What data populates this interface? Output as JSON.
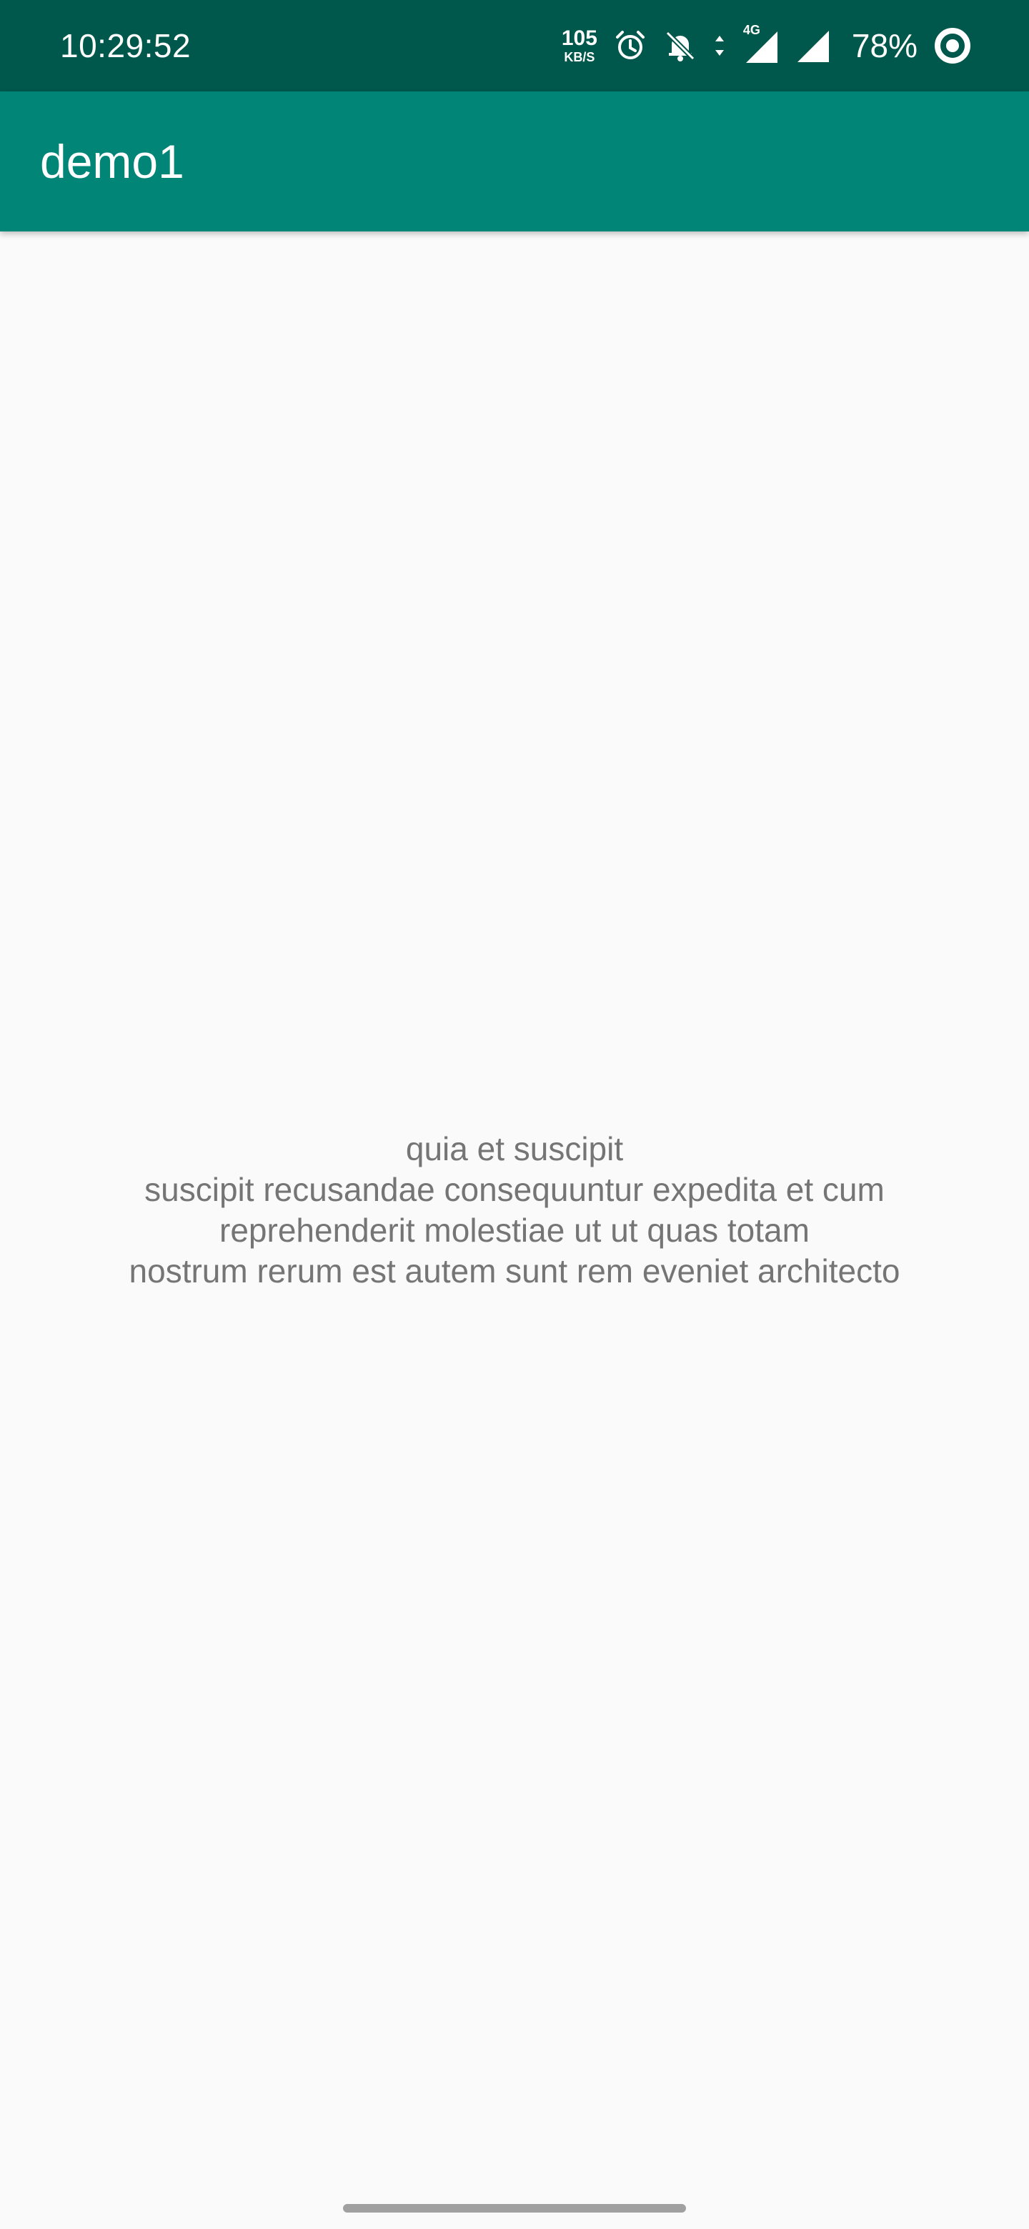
{
  "status_bar": {
    "time": "10:29:52",
    "net_speed_value": "105",
    "net_speed_unit": "KB/S",
    "network_type": "4G",
    "battery_percent": "78%",
    "icons": [
      "alarm-icon",
      "bell-off-icon",
      "data-arrows-icon",
      "signal-4g-icon",
      "signal-icon",
      "battery-ring-icon"
    ]
  },
  "app_bar": {
    "title": "demo1"
  },
  "content": {
    "lines": [
      "quia et suscipit",
      "suscipit recusandae consequuntur expedita et cum",
      "reprehenderit molestiae ut ut quas totam",
      "nostrum rerum est autem sunt rem eveniet architecto"
    ]
  },
  "colors": {
    "status_bar": "#00574b",
    "app_bar": "#008577",
    "background": "#fafafa",
    "body_text": "#757575"
  }
}
